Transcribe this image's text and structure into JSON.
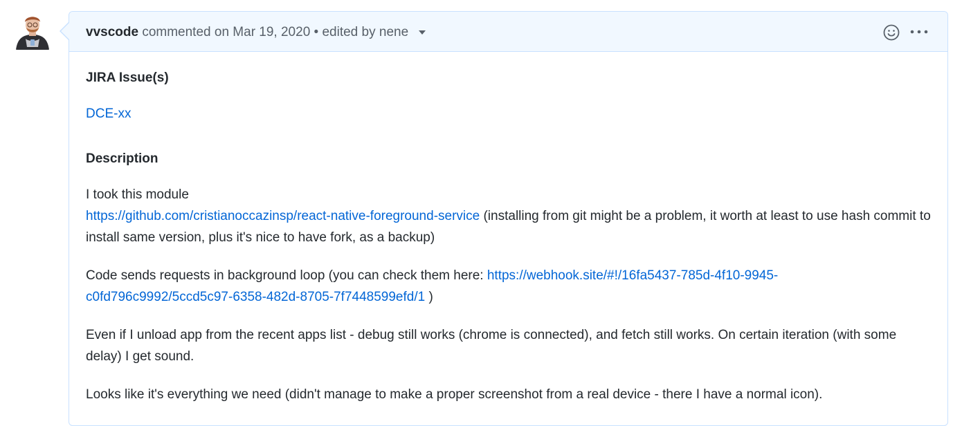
{
  "comment": {
    "author": "vvscode",
    "action": "commented on",
    "date": "Mar 19, 2020",
    "separator": "•",
    "edited_label": "edited by",
    "editor": "nene",
    "reaction_icon": "smiley-icon",
    "more_icon": "kebab-horizontal-icon"
  },
  "body": {
    "jira_heading": "JIRA Issue(s)",
    "jira_link": "DCE-xx",
    "description_heading": "Description",
    "p1_text_start": "I took this module",
    "p1_link": "https://github.com/cristianoccazinsp/react-native-foreground-service",
    "p1_text_end": " (installing from git might be a problem, it worth at least to use hash commit to install same version, plus it's nice to have fork, as a backup)",
    "p2_text_start": "Code sends requests in background loop (you can check them here: ",
    "p2_link_line1": "https://webhook.site/#!/16fa5437-785d-4f10-9945-",
    "p2_link_line2": "c0fd796c9992/5ccd5c97-6358-482d-8705-7f7448599efd/1",
    "p2_text_end": " )",
    "p3_text": "Even if I unload app from the recent apps list - debug still works (chrome is connected), and fetch still works. On certain iteration (with some delay) I get sound.",
    "p4_text": "Looks like it's everything we need (didn't manage to make a proper screenshot from a real device - there I have a normal icon)."
  },
  "colors": {
    "link": "#0366d6",
    "header_bg": "#f1f8ff",
    "border": "#c8e1ff",
    "text": "#24292e",
    "muted": "#586069"
  }
}
